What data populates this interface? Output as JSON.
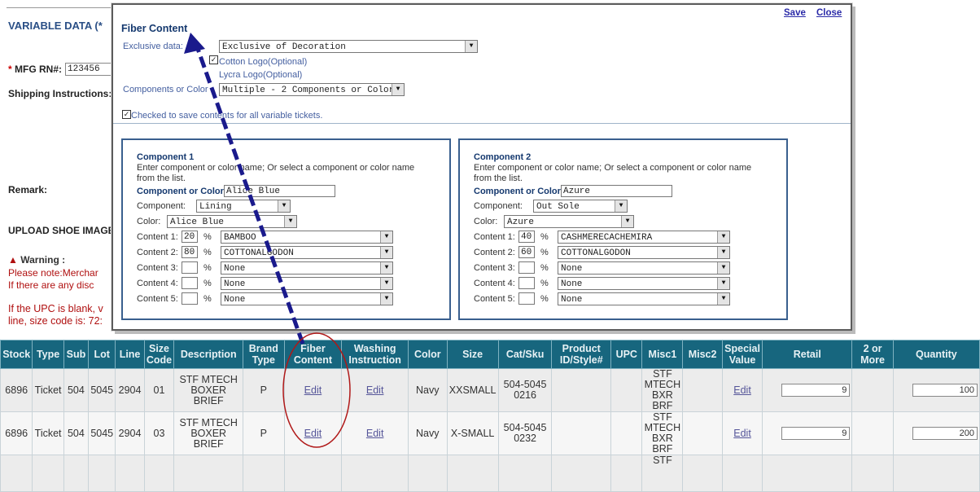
{
  "page": {
    "section_title": "VARIABLE DATA (*",
    "mfg_label": "MFG RN#:",
    "mfg_value": "123456",
    "shipping_label": "Shipping Instructions:",
    "remark_label": "Remark:",
    "upload_label": "UPLOAD SHOE IMAGE",
    "warning_title": "Warning :",
    "warning_lines": [
      "Please note:Merchar",
      "If there are any disc"
    ],
    "upc_lines": [
      "If the UPC is blank, v",
      "line, size code is: 72:"
    ]
  },
  "table": {
    "headers": [
      "Stock",
      "Type",
      "Sub",
      "Lot",
      "Line",
      "Size Code",
      "Description",
      "Brand Type",
      "Fiber Content",
      "Washing Instruction",
      "Color",
      "Size",
      "Cat/Sku",
      "Product ID/Style#",
      "UPC",
      "Misc1",
      "Misc2",
      "Special Value",
      "Retail",
      "2 or More",
      "Quantity"
    ],
    "rows": [
      {
        "stock": "6896",
        "type": "Ticket",
        "sub": "504",
        "lot": "5045",
        "line": "2904",
        "size_code": "01",
        "description": "STF MTECH BOXER BRIEF",
        "brand_type": "P",
        "fiber": "Edit",
        "washing": "Edit",
        "color": "Navy",
        "size": "XXSMALL",
        "cat_sku": "504-5045 0216",
        "product_id": "",
        "upc": "",
        "misc1": "STF MTECH BXR BRF",
        "misc2": "",
        "special": "Edit",
        "retail": "9",
        "two_or_more": "",
        "quantity": "100"
      },
      {
        "stock": "6896",
        "type": "Ticket",
        "sub": "504",
        "lot": "5045",
        "line": "2904",
        "size_code": "03",
        "description": "STF MTECH BOXER BRIEF",
        "brand_type": "P",
        "fiber": "Edit",
        "washing": "Edit",
        "color": "Navy",
        "size": "X-SMALL",
        "cat_sku": "504-5045 0232",
        "product_id": "",
        "upc": "",
        "misc1": "STF MTECH BXR BRF",
        "misc2": "",
        "special": "Edit",
        "retail": "9",
        "two_or_more": "",
        "quantity": "200"
      }
    ],
    "partial_row_misc1": "STF"
  },
  "dialog": {
    "title": "Fiber Content",
    "save_label": "Save",
    "close_label": "Close",
    "exclusive_label": "Exclusive data:",
    "exclusive_value": "Exclusive of Decoration",
    "cotton_logo_label": "Cotton Logo(Optional)",
    "cotton_logo_checked": true,
    "lycra_logo_label": "Lycra Logo(Optional)",
    "components_label": "Components or Color",
    "components_value": "Multiple - 2 Components or Colors",
    "save_all_label": "Checked to save contents for all variable tickets.",
    "save_all_checked": true,
    "components": [
      {
        "title": "Component 1",
        "instruction": [
          "Enter component or color name; Or select a component or color name",
          "from the list."
        ],
        "name_label": "Component or Color:",
        "name_value": "Alice Blue",
        "component_label": "Component:",
        "component_value": "Lining",
        "color_label": "Color:",
        "color_value": "Alice Blue",
        "contents": [
          {
            "label": "Content 1:",
            "pct": "20",
            "pct_sign": "%",
            "fiber": "BAMBOO"
          },
          {
            "label": "Content 2:",
            "pct": "80",
            "pct_sign": "%",
            "fiber": "COTTONALGODON"
          },
          {
            "label": "Content 3:",
            "pct": "",
            "pct_sign": "%",
            "fiber": "None"
          },
          {
            "label": "Content 4:",
            "pct": "",
            "pct_sign": "%",
            "fiber": "None"
          },
          {
            "label": "Content 5:",
            "pct": "",
            "pct_sign": "%",
            "fiber": "None"
          }
        ]
      },
      {
        "title": "Component 2",
        "instruction": [
          "Enter component or color name; Or select a component or color name",
          "from the list."
        ],
        "name_label": "Component or Color:",
        "name_value": "Azure",
        "component_label": "Component:",
        "component_value": "Out Sole",
        "color_label": "Color:",
        "color_value": "Azure",
        "contents": [
          {
            "label": "Content 1:",
            "pct": "40",
            "pct_sign": "%",
            "fiber": "CASHMERECACHEMIRA"
          },
          {
            "label": "Content 2:",
            "pct": "60",
            "pct_sign": "%",
            "fiber": "COTTONALGODON"
          },
          {
            "label": "Content 3:",
            "pct": "",
            "pct_sign": "%",
            "fiber": "None"
          },
          {
            "label": "Content 4:",
            "pct": "",
            "pct_sign": "%",
            "fiber": "None"
          },
          {
            "label": "Content 5:",
            "pct": "",
            "pct_sign": "%",
            "fiber": "None"
          }
        ]
      }
    ]
  },
  "colors": {
    "header_bg": "#17667e",
    "annotation_arrow": "#1a1a8c",
    "annotation_circle": "#b01818",
    "dialog_title": "#14386e"
  },
  "icons": {
    "warning": "warning-triangle-icon",
    "dropdown": "chevron-down-icon",
    "checkbox": "checkbox-icon"
  }
}
